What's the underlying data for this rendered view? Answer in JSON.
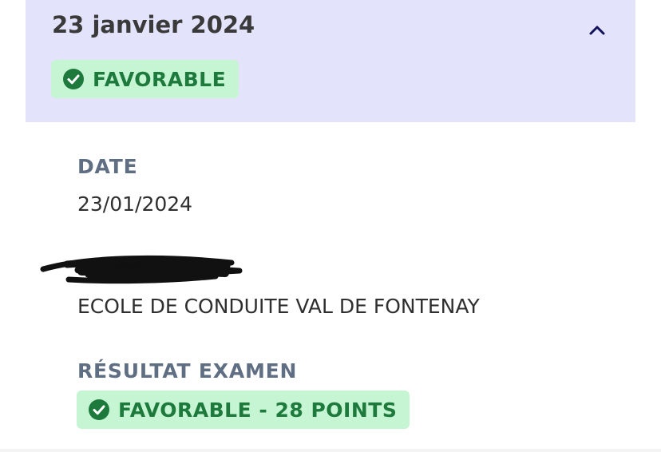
{
  "header": {
    "title": "23 janvier 2024",
    "status_badge": "FAVORABLE",
    "toggle_icon": "chevron-up-icon"
  },
  "details": {
    "date_label": "DATE",
    "date_value": "23/01/2024",
    "school_value": "ECOLE DE CONDUITE VAL DE FONTENAY",
    "result_label": "RÉSULTAT EXAMEN",
    "result_badge": "FAVORABLE - 28 POINTS"
  },
  "colors": {
    "header_background": "#e3e3fb",
    "badge_background": "#c5f5d2",
    "badge_text": "#1e7a3c",
    "label_text": "#5f6e83",
    "title_text": "#3a3a3a"
  },
  "icons": {
    "status": "check-circle-icon",
    "toggle": "chevron-up-icon"
  }
}
